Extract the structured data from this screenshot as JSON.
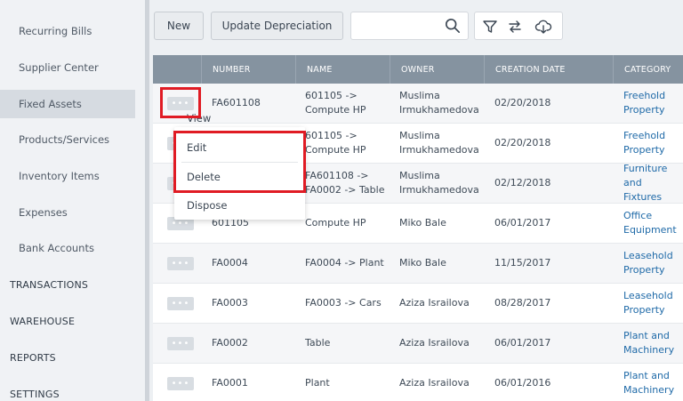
{
  "sidebar": {
    "items": [
      {
        "label": "Recurring Bills"
      },
      {
        "label": "Supplier Center"
      },
      {
        "label": "Fixed Assets"
      },
      {
        "label": "Products/Services"
      },
      {
        "label": "Inventory Items"
      },
      {
        "label": "Expenses"
      },
      {
        "label": "Bank Accounts"
      }
    ],
    "sections": [
      {
        "label": "TRANSACTIONS"
      },
      {
        "label": "WAREHOUSE"
      },
      {
        "label": "REPORTS"
      },
      {
        "label": "SETTINGS"
      }
    ]
  },
  "toolbar": {
    "new_label": "New",
    "update_label": "Update Depreciation",
    "search_value": ""
  },
  "table": {
    "headers": [
      "NUMBER",
      "NAME",
      "OWNER",
      "CREATION DATE",
      "CATEGORY"
    ],
    "rows": [
      {
        "number": "FA601108",
        "name": [
          "601105 ->",
          "Compute HP"
        ],
        "owner": [
          "Muslima",
          "Irmukhamedova"
        ],
        "date": "02/20/2018",
        "category": [
          "Freehold",
          "Property"
        ]
      },
      {
        "number": "",
        "name": [
          "601105 ->",
          "Compute HP"
        ],
        "owner": [
          "Muslima",
          "Irmukhamedova"
        ],
        "date": "02/20/2018",
        "category": [
          "Freehold",
          "Property"
        ]
      },
      {
        "number": "",
        "name": [
          "FA601108 ->",
          "FA0002 -> Table"
        ],
        "owner": [
          "Muslima",
          "Irmukhamedova"
        ],
        "date": "02/12/2018",
        "category": [
          "Furniture and",
          "Fixtures"
        ]
      },
      {
        "number": "601105",
        "name": [
          "Compute HP"
        ],
        "owner": [
          "Miko Bale"
        ],
        "date": "06/01/2017",
        "category": [
          "Office",
          "Equipment"
        ]
      },
      {
        "number": "FA0004",
        "name": [
          "FA0004 -> Plant"
        ],
        "owner": [
          "Miko Bale"
        ],
        "date": "11/15/2017",
        "category": [
          "Leasehold",
          "Property"
        ]
      },
      {
        "number": "FA0003",
        "name": [
          "FA0003 -> Cars"
        ],
        "owner": [
          "Aziza Israilova"
        ],
        "date": "08/28/2017",
        "category": [
          "Leasehold",
          "Property"
        ]
      },
      {
        "number": "FA0002",
        "name": [
          "Table"
        ],
        "owner": [
          "Aziza Israilova"
        ],
        "date": "06/01/2017",
        "category": [
          "Plant and",
          "Machinery"
        ]
      },
      {
        "number": "FA0001",
        "name": [
          "Plant"
        ],
        "owner": [
          "Aziza Israilova"
        ],
        "date": "06/01/2016",
        "category": [
          "Plant and",
          "Machinery"
        ]
      }
    ],
    "more_glyph": "•••"
  },
  "context_menu": {
    "items": [
      {
        "label": "View"
      },
      {
        "label": "Edit"
      },
      {
        "label": "Delete"
      },
      {
        "label": "Dispose"
      }
    ]
  },
  "colors": {
    "header_bg": "#8593a0",
    "category_link": "#1f6aa8",
    "highlight": "#e01b24",
    "sidebar_active": "#d6dbe1"
  }
}
